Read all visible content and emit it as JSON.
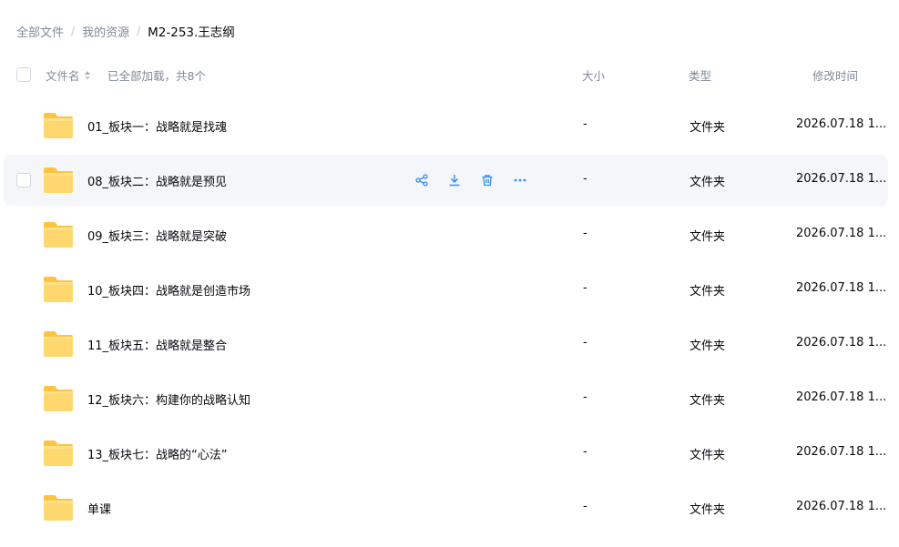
{
  "breadcrumb": {
    "items": [
      "全部文件",
      "我的资源"
    ],
    "separator": "/",
    "current": "M2-253.王志纲"
  },
  "header": {
    "name_label": "文件名",
    "count_label": "已全部加载，共8个",
    "size_label": "大小",
    "type_label": "类型",
    "time_label": "修改时间"
  },
  "colors": {
    "folder_body": "#fed76f",
    "folder_tab": "#ffc43d",
    "action_blue": "#2f8cf5",
    "hover_bg": "#f5f6fa"
  },
  "rows": [
    {
      "name": "01_板块一：战略就是找魂",
      "size": "-",
      "type": "文件夹",
      "time": "2026.07.18 1..."
    },
    {
      "name": "08_板块二：战略就是预见",
      "size": "-",
      "type": "文件夹",
      "time": "2026.07.18 1...",
      "hovered": true
    },
    {
      "name": "09_板块三：战略就是突破",
      "size": "-",
      "type": "文件夹",
      "time": "2026.07.18 1..."
    },
    {
      "name": "10_板块四：战略就是创造市场",
      "size": "-",
      "type": "文件夹",
      "time": "2026.07.18 1..."
    },
    {
      "name": "11_板块五：战略就是整合",
      "size": "-",
      "type": "文件夹",
      "time": "2026.07.18 1..."
    },
    {
      "name": "12_板块六：构建你的战略认知",
      "size": "-",
      "type": "文件夹",
      "time": "2026.07.18 1..."
    },
    {
      "name": "13_板块七：战略的“心法”",
      "size": "-",
      "type": "文件夹",
      "time": "2026.07.18 1..."
    },
    {
      "name": "单课",
      "size": "-",
      "type": "文件夹",
      "time": "2026.07.18 1..."
    }
  ],
  "row_actions": [
    "share-icon",
    "download-icon",
    "delete-icon",
    "more-icon"
  ]
}
